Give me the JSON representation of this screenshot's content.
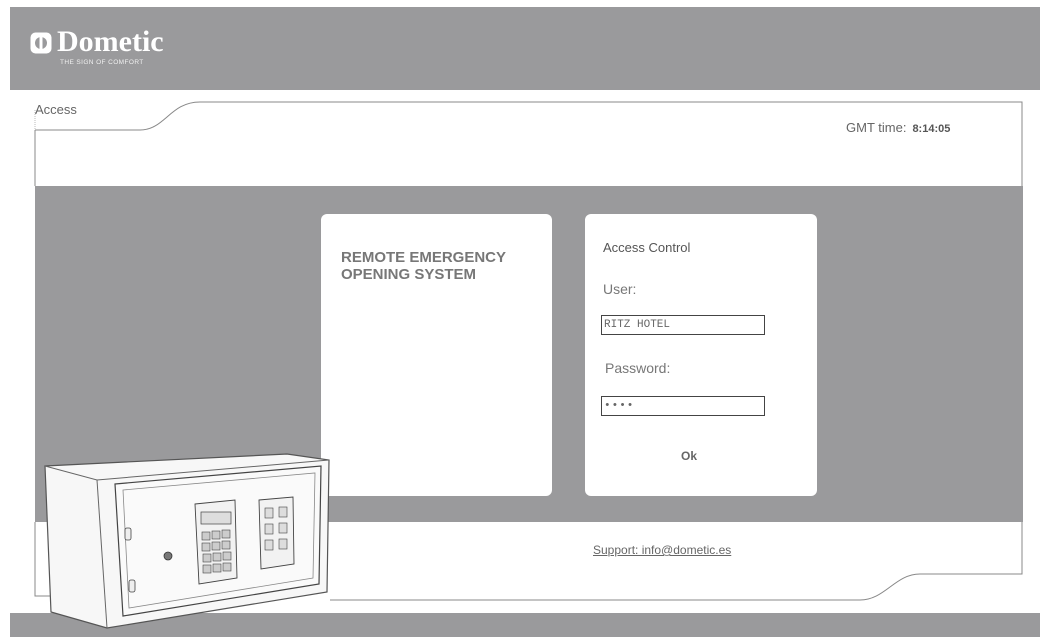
{
  "header": {
    "brand": "Dometic",
    "tagline": "THE SIGN OF COMFORT"
  },
  "top": {
    "tab_label": "Access",
    "gmt_label": "GMT time:",
    "gmt_time": "8:14:05"
  },
  "left_card": {
    "title": "REMOTE EMERGENCY OPENING SYSTEM"
  },
  "login": {
    "title": "Access Control",
    "user_label": "User:",
    "user_value": "RITZ HOTEL",
    "password_label": "Password:",
    "password_value": "••••",
    "ok_label": "Ok"
  },
  "footer": {
    "support_text": "Support: info@dometic.es"
  },
  "colors": {
    "band": "#9a9a9c",
    "card": "#ffffff"
  },
  "icons": {
    "logo": "dometic-logo-icon",
    "illustration": "safe-illustration"
  }
}
